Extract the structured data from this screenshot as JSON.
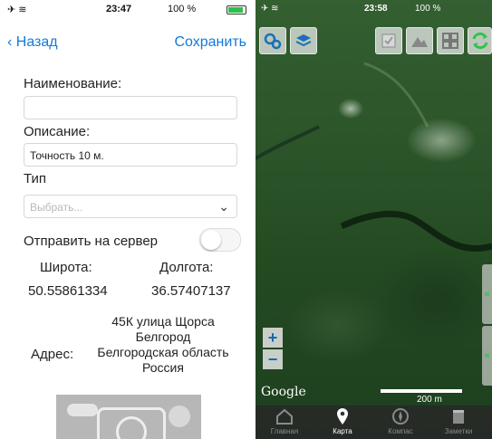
{
  "left_status": {
    "time": "23:47",
    "battery": "100 %"
  },
  "nav": {
    "back_label": "Назад",
    "save_label": "Сохранить"
  },
  "form": {
    "name_label": "Наименование:",
    "name_value": "",
    "description_label": "Описание:",
    "description_value": "Точность 10 м.",
    "type_label": "Тип",
    "type_placeholder": "Выбрать...",
    "send_label": "Отправить на сервер",
    "send_enabled": false,
    "latitude_label": "Широта:",
    "longitude_label": "Долгота:",
    "latitude_value": "50.55861334",
    "longitude_value": "36.57407137",
    "address_label": "Адрес:",
    "address_lines": [
      "45К улица Щорса",
      "Белгород",
      "Белгородская область",
      "Россия"
    ]
  },
  "right_status": {
    "time": "23:58",
    "battery": "100 %"
  },
  "map": {
    "attribution": "Google",
    "scale_label": "200 m",
    "zoom_in": "+",
    "zoom_out": "−",
    "accent": "#2cc44c"
  },
  "tabs": [
    {
      "label": "Главная",
      "icon": "home-icon",
      "active": false
    },
    {
      "label": "Карта",
      "icon": "map-pin-icon",
      "active": true
    },
    {
      "label": "Компас",
      "icon": "compass-icon",
      "active": false
    },
    {
      "label": "Заметки",
      "icon": "notes-icon",
      "active": false
    }
  ]
}
